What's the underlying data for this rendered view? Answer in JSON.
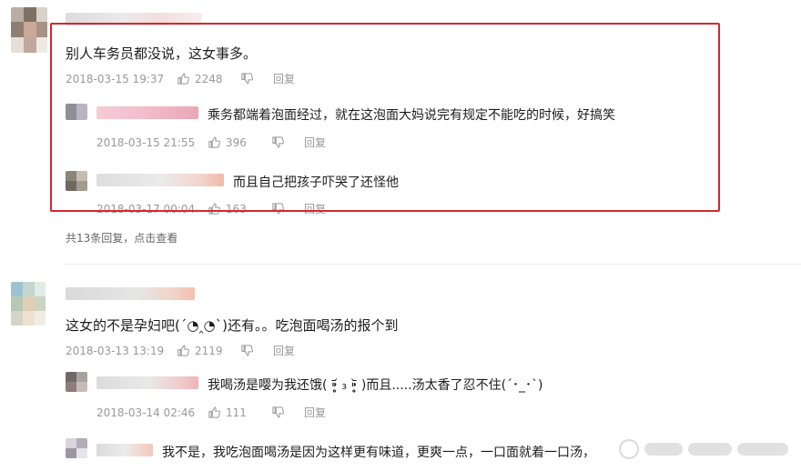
{
  "comments": [
    {
      "text": "别人车务员都没说，这女事多。",
      "time": "2018-03-15 19:37",
      "likes": "2248",
      "reply_label": "回复",
      "replies": [
        {
          "text": "乘务都端着泡面经过，就在这泡面大妈说完有规定不能吃的时候，好搞笑",
          "time": "2018-03-15 21:55",
          "likes": "396",
          "reply_label": "回复"
        },
        {
          "text": "而且自己把孩子吓哭了还怪他",
          "time": "2018-03-17 00:04",
          "likes": "163",
          "reply_label": "回复"
        }
      ],
      "more_replies": "共13条回复，点击查看"
    },
    {
      "text": "这女的不是孕妇吧(´◔‸◔`)还有。。吃泡面喝汤的报个到",
      "time": "2018-03-13 13:19",
      "likes": "2119",
      "reply_label": "回复",
      "replies": [
        {
          "text": "我喝汤是嘤为我还饿( ⁍̥̥̥᷄ ₃ ⁍̥̥̥᷅ )而且.....汤太香了忍不住(´･_･`)",
          "time": "2018-03-14 02:46",
          "likes": "111",
          "reply_label": "回复"
        },
        {
          "text": "我不是，我吃泡面喝汤是因为这样更有味道，更爽一点，一口面就着一口汤，",
          "time": "",
          "likes": "",
          "reply_label": ""
        }
      ]
    }
  ],
  "colors": {
    "highlight": "#d6282d",
    "meta": "#999999",
    "text": "#1c1c1c"
  },
  "icons": {
    "like": "thumbs-up-icon",
    "dislike": "thumbs-down-icon"
  }
}
